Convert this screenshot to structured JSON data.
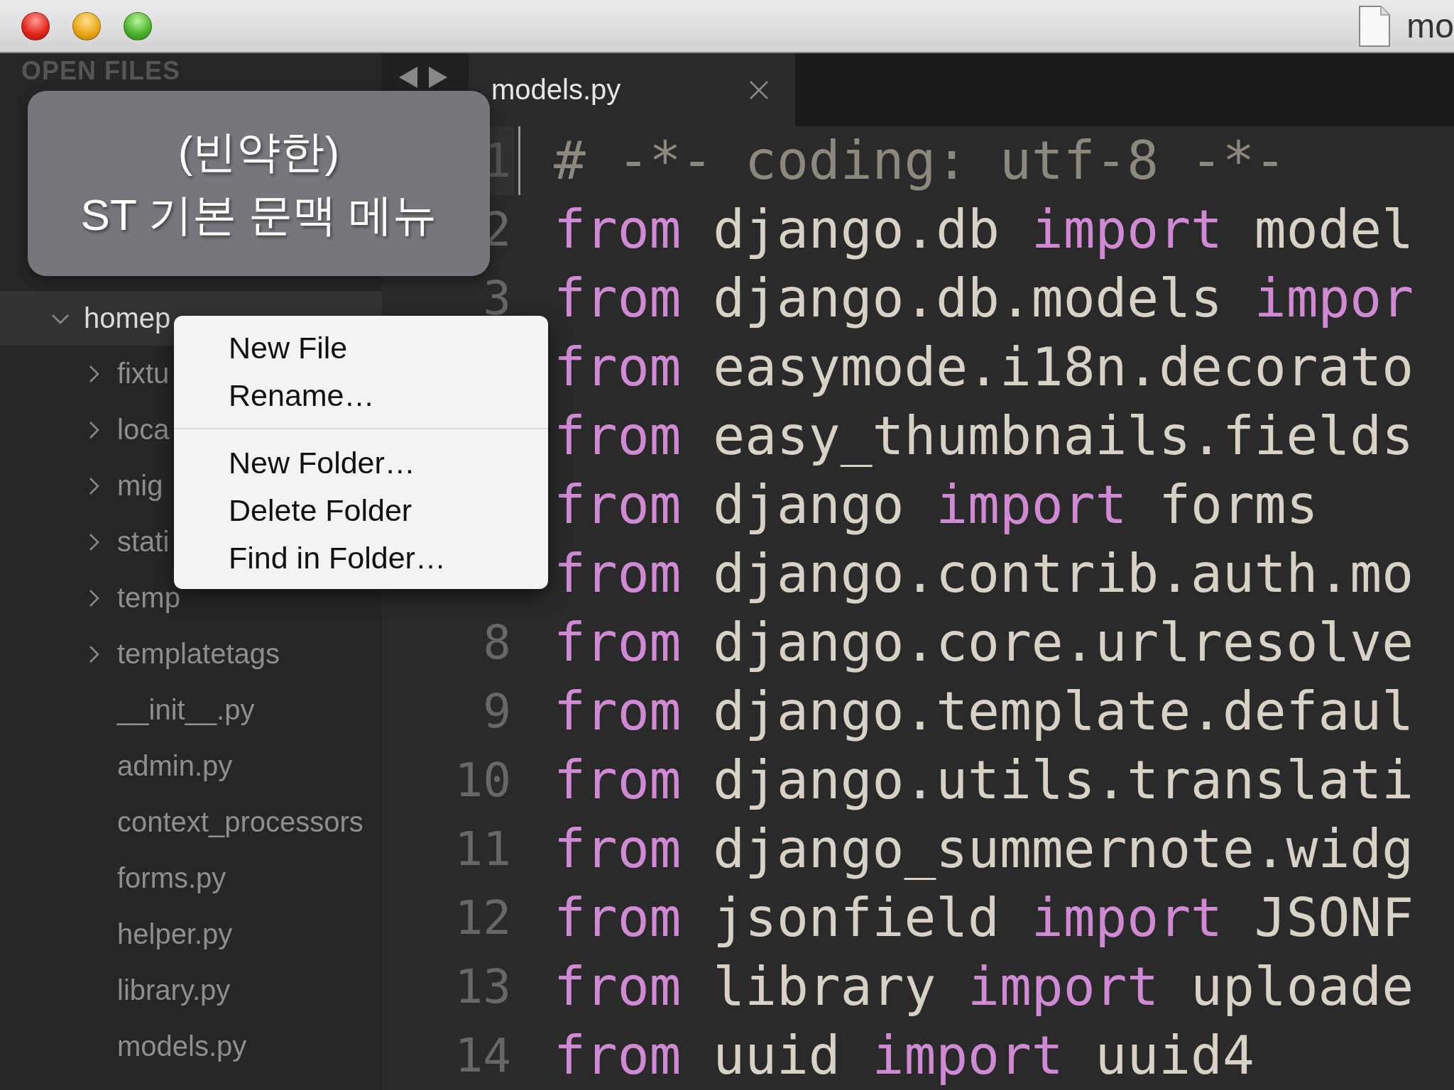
{
  "window": {
    "title": "mo"
  },
  "sidebar": {
    "header": "OPEN FILES",
    "folders": [
      {
        "name": "homep",
        "expanded": true,
        "selected": true,
        "children": [
          {
            "name": "fixtu",
            "kind": "folder",
            "expanded": false
          },
          {
            "name": "loca",
            "kind": "folder",
            "expanded": false
          },
          {
            "name": "mig",
            "kind": "folder",
            "expanded": false
          },
          {
            "name": "stati",
            "kind": "folder",
            "expanded": false
          },
          {
            "name": "temp",
            "kind": "folder",
            "expanded": false
          },
          {
            "name": "templatetags",
            "kind": "folder",
            "expanded": false
          },
          {
            "name": "__init__.py",
            "kind": "file"
          },
          {
            "name": "admin.py",
            "kind": "file"
          },
          {
            "name": "context_processors",
            "kind": "file"
          },
          {
            "name": "forms.py",
            "kind": "file"
          },
          {
            "name": "helper.py",
            "kind": "file"
          },
          {
            "name": "library.py",
            "kind": "file"
          },
          {
            "name": "models.py",
            "kind": "file"
          }
        ]
      }
    ]
  },
  "caption": [
    "(빈약한)",
    "ST 기본 문맥 메뉴"
  ],
  "context_menu": {
    "groups": [
      [
        "New File",
        "Rename…"
      ],
      [
        "New Folder…",
        "Delete Folder",
        "Find in Folder…"
      ]
    ]
  },
  "tabs": [
    {
      "label": "models.py",
      "selected": true
    }
  ],
  "editor": {
    "lines": [
      {
        "number": "1",
        "current": true,
        "tokens": [
          {
            "kind": "comment",
            "text": "# -*- coding: utf-8 -*-"
          }
        ]
      },
      {
        "number": "2",
        "current": false,
        "tokens": [
          {
            "kind": "keyword",
            "text": "from"
          },
          {
            "kind": "plain",
            "text": " django.db "
          },
          {
            "kind": "keyword",
            "text": "import"
          },
          {
            "kind": "plain",
            "text": " model"
          }
        ]
      },
      {
        "number": "3",
        "current": false,
        "tokens": [
          {
            "kind": "keyword",
            "text": "from"
          },
          {
            "kind": "plain",
            "text": " django.db.models "
          },
          {
            "kind": "keyword",
            "text": "impor"
          }
        ]
      },
      {
        "tokens": [
          {
            "kind": "keyword",
            "text": "from"
          },
          {
            "kind": "plain",
            "text": " easymode.i18n.decorato"
          }
        ]
      },
      {
        "tokens": [
          {
            "kind": "keyword",
            "text": "from"
          },
          {
            "kind": "plain",
            "text": " easy_thumbnails.fields"
          }
        ]
      },
      {
        "tokens": [
          {
            "kind": "keyword",
            "text": "from"
          },
          {
            "kind": "plain",
            "text": " django "
          },
          {
            "kind": "keyword",
            "text": "import"
          },
          {
            "kind": "plain",
            "text": " forms"
          }
        ]
      },
      {
        "tokens": [
          {
            "kind": "keyword",
            "text": "from"
          },
          {
            "kind": "plain",
            "text": " django.contrib.auth.mo"
          }
        ]
      },
      {
        "number": "8",
        "current": false,
        "tokens": [
          {
            "kind": "keyword",
            "text": "from"
          },
          {
            "kind": "plain",
            "text": " django.core.urlresolve"
          }
        ]
      },
      {
        "number": "9",
        "current": false,
        "tokens": [
          {
            "kind": "keyword",
            "text": "from"
          },
          {
            "kind": "plain",
            "text": " django.template.defaul"
          }
        ]
      },
      {
        "number": "10",
        "current": false,
        "tokens": [
          {
            "kind": "keyword",
            "text": "from"
          },
          {
            "kind": "plain",
            "text": " django.utils.translati"
          }
        ]
      },
      {
        "number": "11",
        "current": false,
        "tokens": [
          {
            "kind": "keyword",
            "text": "from"
          },
          {
            "kind": "plain",
            "text": " django_summernote.widg"
          }
        ]
      },
      {
        "number": "12",
        "current": false,
        "tokens": [
          {
            "kind": "keyword",
            "text": "from"
          },
          {
            "kind": "plain",
            "text": " jsonfield "
          },
          {
            "kind": "keyword",
            "text": "import"
          },
          {
            "kind": "plain",
            "text": " JSONF"
          }
        ]
      },
      {
        "number": "13",
        "current": false,
        "tokens": [
          {
            "kind": "keyword",
            "text": "from"
          },
          {
            "kind": "plain",
            "text": " library "
          },
          {
            "kind": "keyword",
            "text": "import"
          },
          {
            "kind": "plain",
            "text": " uploade"
          }
        ]
      },
      {
        "number": "14",
        "current": false,
        "tokens": [
          {
            "kind": "keyword",
            "text": "from"
          },
          {
            "kind": "plain",
            "text": " uuid "
          },
          {
            "kind": "keyword",
            "text": "import"
          },
          {
            "kind": "plain",
            "text": " uuid4"
          }
        ]
      }
    ]
  }
}
